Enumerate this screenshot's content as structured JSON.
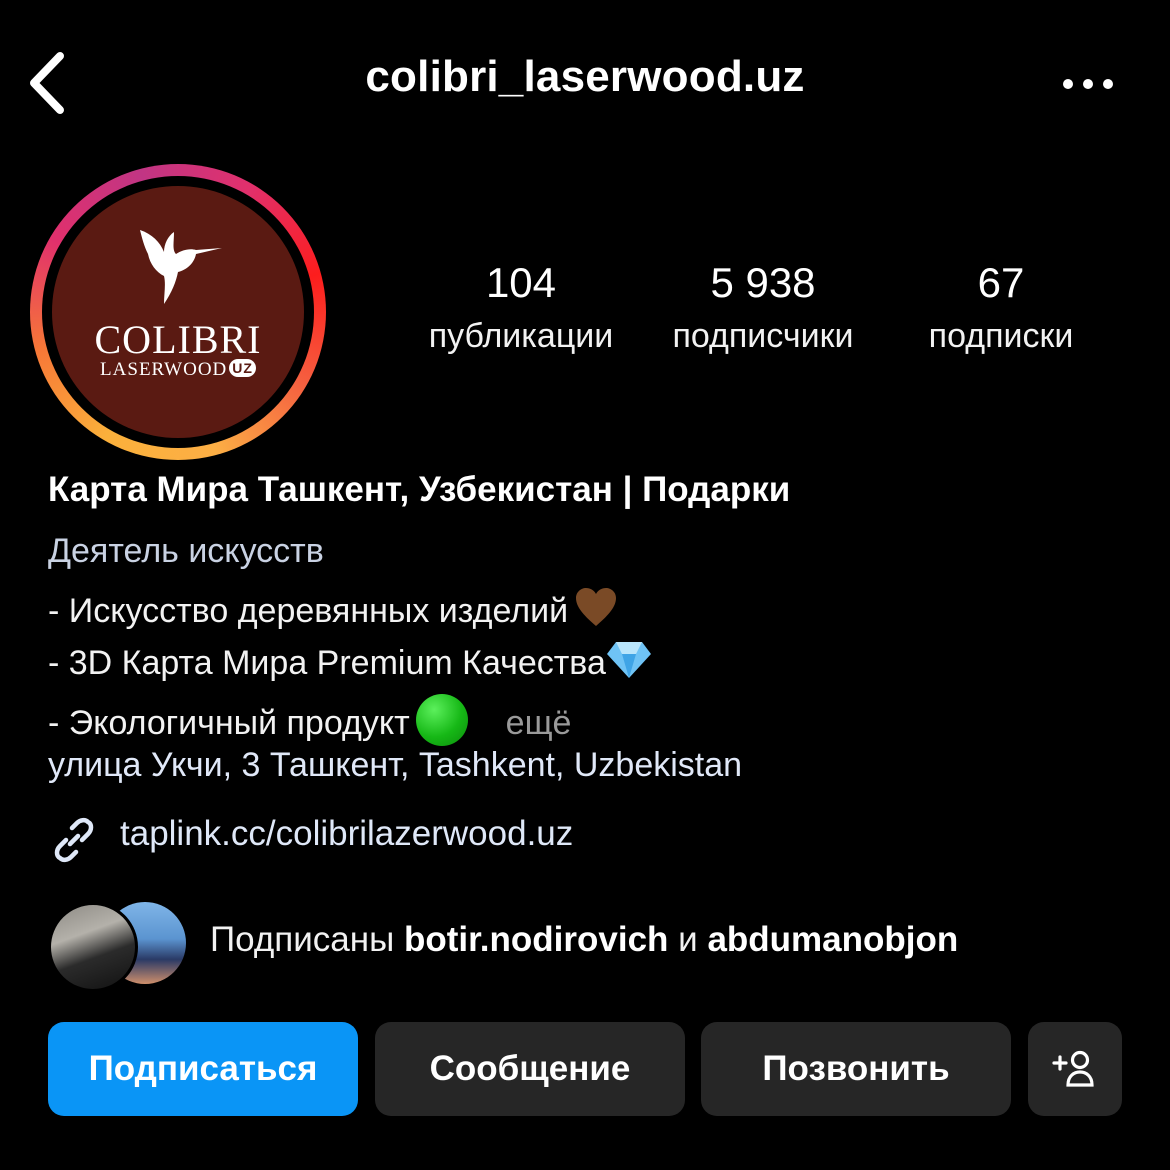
{
  "header": {
    "username": "colibri_laserwood.uz",
    "back_icon": "chevron-left-icon",
    "more_icon": "more-horizontal-icon"
  },
  "avatar": {
    "logo_main": "COLIBRI",
    "logo_sub": "LASERWOOD",
    "logo_badge": "UZ"
  },
  "stats": {
    "posts": {
      "value": "104",
      "label": "публикации"
    },
    "followers": {
      "value": "5 938",
      "label": "подписчики"
    },
    "following": {
      "value": "67",
      "label": "подписки"
    }
  },
  "bio": {
    "name": "Карта Мира Ташкент, Узбекистан | Подарки",
    "category": "Деятель искусств",
    "line1": "- Искусство деревянных изделий",
    "line2": "- 3D Карта Мира Premium Качества",
    "line3": "- Экологичный продукт",
    "more": "ещё",
    "address": "улица Укчи, 3 Ташкент, Tashkent, Uzbekistan",
    "link": "taplink.cc/colibrilazerwood.uz"
  },
  "mutual": {
    "prefix": "Подписаны",
    "user1": "botir.nodirovich",
    "joiner": "и",
    "user2": "abdumanobjon"
  },
  "actions": {
    "follow": "Подписаться",
    "message": "Сообщение",
    "call": "Позвонить"
  },
  "colors": {
    "follow_button": "#0a95f6",
    "secondary_button": "#262626",
    "background": "#000000",
    "avatar_bg": "#5a1a12"
  }
}
